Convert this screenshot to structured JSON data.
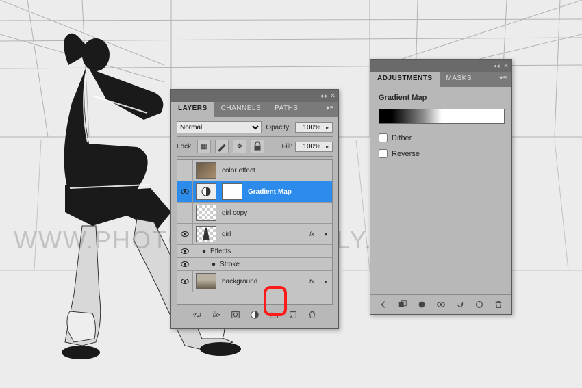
{
  "watermark": "WWW.PHOTOSHOPSUPPLY.COM",
  "layersPanel": {
    "tabs": [
      "LAYERS",
      "CHANNELS",
      "PATHS"
    ],
    "blendMode": "Normal",
    "opacityLabel": "Opacity:",
    "opacityValue": "100%",
    "lockLabel": "Lock:",
    "fillLabel": "Fill:",
    "fillValue": "100%",
    "layers": [
      {
        "name": "color effect"
      },
      {
        "name": "Gradient Map"
      },
      {
        "name": "girl copy"
      },
      {
        "name": "girl"
      },
      {
        "effectsLabel": "Effects"
      },
      {
        "strokeLabel": "Stroke"
      },
      {
        "name": "background"
      }
    ]
  },
  "adjPanel": {
    "tabs": [
      "ADJUSTMENTS",
      "MASKS"
    ],
    "title": "Gradient Map",
    "ditherLabel": "Dither",
    "reverseLabel": "Reverse"
  }
}
